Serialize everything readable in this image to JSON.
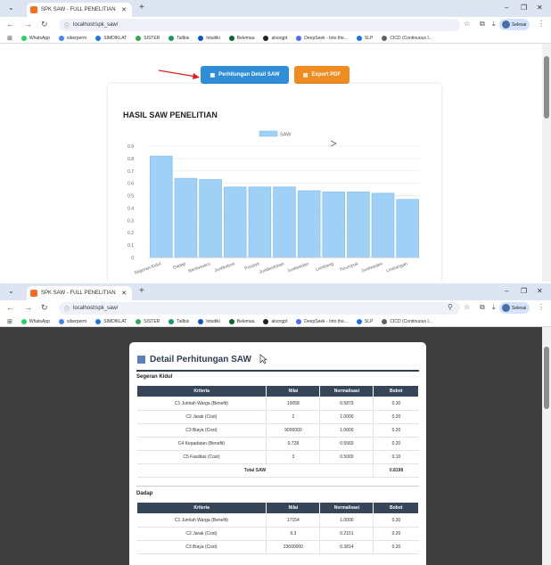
{
  "browser": {
    "tab_title": "SPK SAW - FULL PENELITIAN",
    "url": "localhost/spk_saw/",
    "bookmarks": [
      {
        "label": "WhatsApp",
        "color": "#25d366"
      },
      {
        "label": "siberperm",
        "color": "#4285f4"
      },
      {
        "label": "SIMDIKLAT",
        "color": "#1a73e8"
      },
      {
        "label": "SISTER",
        "color": "#34a853"
      },
      {
        "label": "Tallbis",
        "color": "#0f9d58"
      },
      {
        "label": "Intuitiki",
        "color": "#0b57d0"
      },
      {
        "label": "Belemaa",
        "color": "#0d652d"
      },
      {
        "label": "alsorgpt",
        "color": "#202124"
      },
      {
        "label": "DeepSeek - Into the...",
        "color": "#4d6bfe"
      },
      {
        "label": "SLP",
        "color": "#1a73e8"
      },
      {
        "label": "CICD (Continuous I...",
        "color": "#5f6368"
      }
    ],
    "profile_label": "Selesai",
    "icons": [
      "chevron-down-icon",
      "close-icon",
      "plus-icon",
      "minimize-icon",
      "restore-icon",
      "back-icon",
      "forward-icon",
      "reload-icon",
      "info-icon",
      "star-icon",
      "extensions-icon",
      "download-icon",
      "menu-icon",
      "apps-icon",
      "zoom-icon"
    ]
  },
  "page": {
    "btn_detail": "Perhitungan Detail SAW",
    "btn_export": "Export PDF",
    "colors": {
      "btn_detail": "#2e8fd8",
      "btn_export": "#ef8c22",
      "arrow": "#e02020",
      "bar": "#9fd0f5",
      "bar_border": "#7cbbea",
      "header": "#364558"
    }
  },
  "chart_data": {
    "type": "bar",
    "title": "HASIL SAW PENELITIAN",
    "legend": "SAW",
    "legend_position": "top-center",
    "categories": [
      "Segeran Kidul",
      "Dadap",
      "Bantarwaru",
      "Juntikebon",
      "Pondoh",
      "Juntikedokan",
      "Juntiwedan",
      "Lombang",
      "Tinumpuk",
      "Juntiweden",
      "Limbangan"
    ],
    "values": [
      0.82,
      0.64,
      0.63,
      0.57,
      0.57,
      0.57,
      0.54,
      0.53,
      0.53,
      0.52,
      0.47
    ],
    "ylim": [
      0,
      0.9
    ],
    "yticks": [
      "0",
      "0.1",
      "0.2",
      "0.3",
      "0.4",
      "0.5",
      "0.6",
      "0.7",
      "0.8",
      "0.9"
    ],
    "grid": true
  },
  "detail": {
    "title": "Detail Perhitungan SAW",
    "headers": [
      "Kriteria",
      "Nilai",
      "Normalisasi",
      "Bobot"
    ],
    "sections": [
      {
        "name": "Segeran Kidul",
        "rows": [
          [
            "C1 Jumlah Warga (Benefit)",
            "10058",
            "0.5879",
            "0.30"
          ],
          [
            "C2 Jarak (Cost)",
            "2",
            "1.0000",
            "0.20"
          ],
          [
            "C3 Biaya (Cost)",
            "9000000",
            "1.0000",
            "0.20"
          ],
          [
            "C4 Kepadatan (Benefit)",
            "0.728",
            "0.5569",
            "0.20"
          ],
          [
            "C5 Fasilitas (Cost)",
            "3",
            "0.5000",
            "0.10"
          ]
        ],
        "total_label": "Total SAW",
        "total_value": "0.8198"
      },
      {
        "name": "Dadap",
        "rows": [
          [
            "C1 Jumlah Warga (Benefit)",
            "17154",
            "1.0000",
            "0.30"
          ],
          [
            "C2 Jarak (Cost)",
            "9.3",
            "0.2151",
            "0.20"
          ],
          [
            "C3 Biaya (Cost)",
            "23600000",
            "0.3814",
            "0.20"
          ]
        ]
      }
    ]
  }
}
